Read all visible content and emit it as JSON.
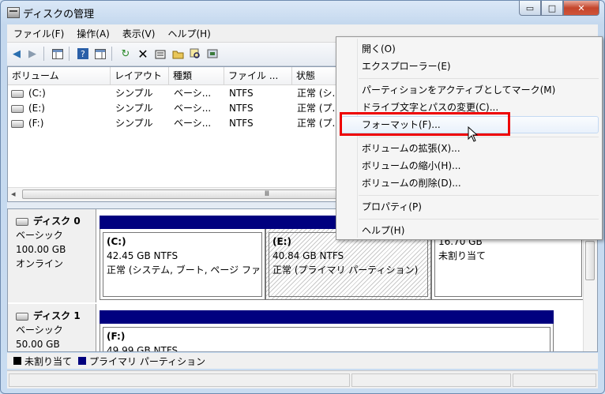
{
  "window": {
    "title": "ディスクの管理",
    "min_glyph": "▭",
    "max_glyph": "□",
    "close_glyph": "✕"
  },
  "menu": [
    "ファイル(F)",
    "操作(A)",
    "表示(V)",
    "ヘルプ(H)"
  ],
  "toolbar_icons": [
    "back-arrow-icon",
    "forward-arrow-icon",
    "console-tree-icon",
    "help-icon",
    "properties-pane-icon",
    "refresh-icon",
    "delete-icon",
    "properties-icon",
    "open-folder-icon",
    "explore-icon",
    "rescan-disk-icon"
  ],
  "table": {
    "columns": [
      "ボリューム",
      "レイアウト",
      "種類",
      "ファイル ...",
      "状態"
    ],
    "rows": [
      {
        "volume": "(C:)",
        "layout": "シンプル",
        "type": "ベーシ...",
        "fs": "NTFS",
        "status": "正常 (シ..."
      },
      {
        "volume": "(E:)",
        "layout": "シンプル",
        "type": "ベーシ...",
        "fs": "NTFS",
        "status": "正常 (プ..."
      },
      {
        "volume": "(F:)",
        "layout": "シンプル",
        "type": "ベーシ...",
        "fs": "NTFS",
        "status": "正常 (プ..."
      }
    ],
    "scroll_left": "◂",
    "scroll_grip": "Ⅲ"
  },
  "disks": [
    {
      "name": "ディスク 0",
      "kind": "ベーシック",
      "size": "100.00 GB",
      "state": "オンライン",
      "partitions": [
        {
          "label": "(C:)",
          "size": "42.45 GB NTFS",
          "status": "正常 (システム, ブート, ページ ファ"
        },
        {
          "label": "(E:)",
          "size": "40.84 GB NTFS",
          "status": "正常 (プライマリ パーティション)"
        },
        {
          "label": "",
          "size": "16.70 GB",
          "status": "未割り当て"
        }
      ]
    },
    {
      "name": "ディスク 1",
      "kind": "ベーシック",
      "size": "50.00 GB",
      "partitions": [
        {
          "label": "(F:)",
          "size": "49.99 GB NTFS",
          "status": ""
        }
      ]
    }
  ],
  "legend": [
    {
      "label": "未割り当て",
      "color": "#000000"
    },
    {
      "label": "プライマリ パーティション",
      "color": "#00007f"
    }
  ],
  "context_menu": {
    "items": [
      "開く(O)",
      "エクスプローラー(E)",
      "パーティションをアクティブとしてマーク(M)",
      "ドライブ文字とパスの変更(C)...",
      "フォーマット(F)...",
      "ボリュームの拡張(X)...",
      "ボリュームの縮小(H)...",
      "ボリュームの削除(D)...",
      "プロパティ(P)",
      "ヘルプ(H)"
    ],
    "highlighted": "フォーマット(F)..."
  },
  "colors": {
    "accent_bar": "#00007f",
    "highlight_box": "#ee0000"
  }
}
